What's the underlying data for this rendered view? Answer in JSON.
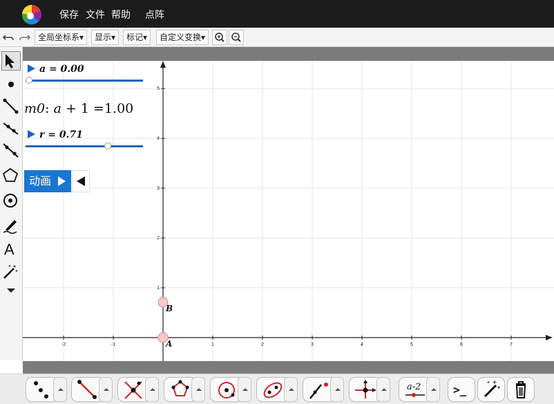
{
  "menu": {
    "save": "保存",
    "file": "文件",
    "help": "帮助",
    "dot_matrix": "点阵"
  },
  "toolbar": {
    "coord_system": "全局坐标系▾",
    "display": "显示▾",
    "mark": "标记▾",
    "custom_transform": "自定义变换▾"
  },
  "sliders": [
    {
      "label": "a = 0.00",
      "value": 0.0,
      "min": 0,
      "max": 1
    },
    {
      "label": "r = 0.71",
      "value": 0.71,
      "min": 0,
      "max": 1
    }
  ],
  "measurement": {
    "name": "m0",
    "colon": ":",
    "expr_var": "a",
    "expr_rest": "+ 1 =1.00"
  },
  "animation": {
    "label": "动画"
  },
  "graph": {
    "x_ticks": [
      "-2",
      "-1",
      "1",
      "2",
      "3",
      "4",
      "5",
      "6",
      "7"
    ],
    "x_values": [
      -2,
      -1,
      1,
      2,
      3,
      4,
      5,
      6,
      7
    ],
    "y_ticks": [
      "1",
      "2",
      "3",
      "4",
      "5"
    ],
    "y_values": [
      1,
      2,
      3,
      4,
      5
    ],
    "points": [
      {
        "label": "A",
        "x": 0,
        "y": 0
      },
      {
        "label": "B",
        "x": 0,
        "y": 0.71
      }
    ],
    "point_fill": "#f7c8cc",
    "point_stroke": "#d88890"
  },
  "bottom_tools": {
    "expression_label": "a-2",
    "terminal_label": ">_"
  },
  "colors": {
    "accent": "#1976d2",
    "slider": "#1565c0"
  }
}
